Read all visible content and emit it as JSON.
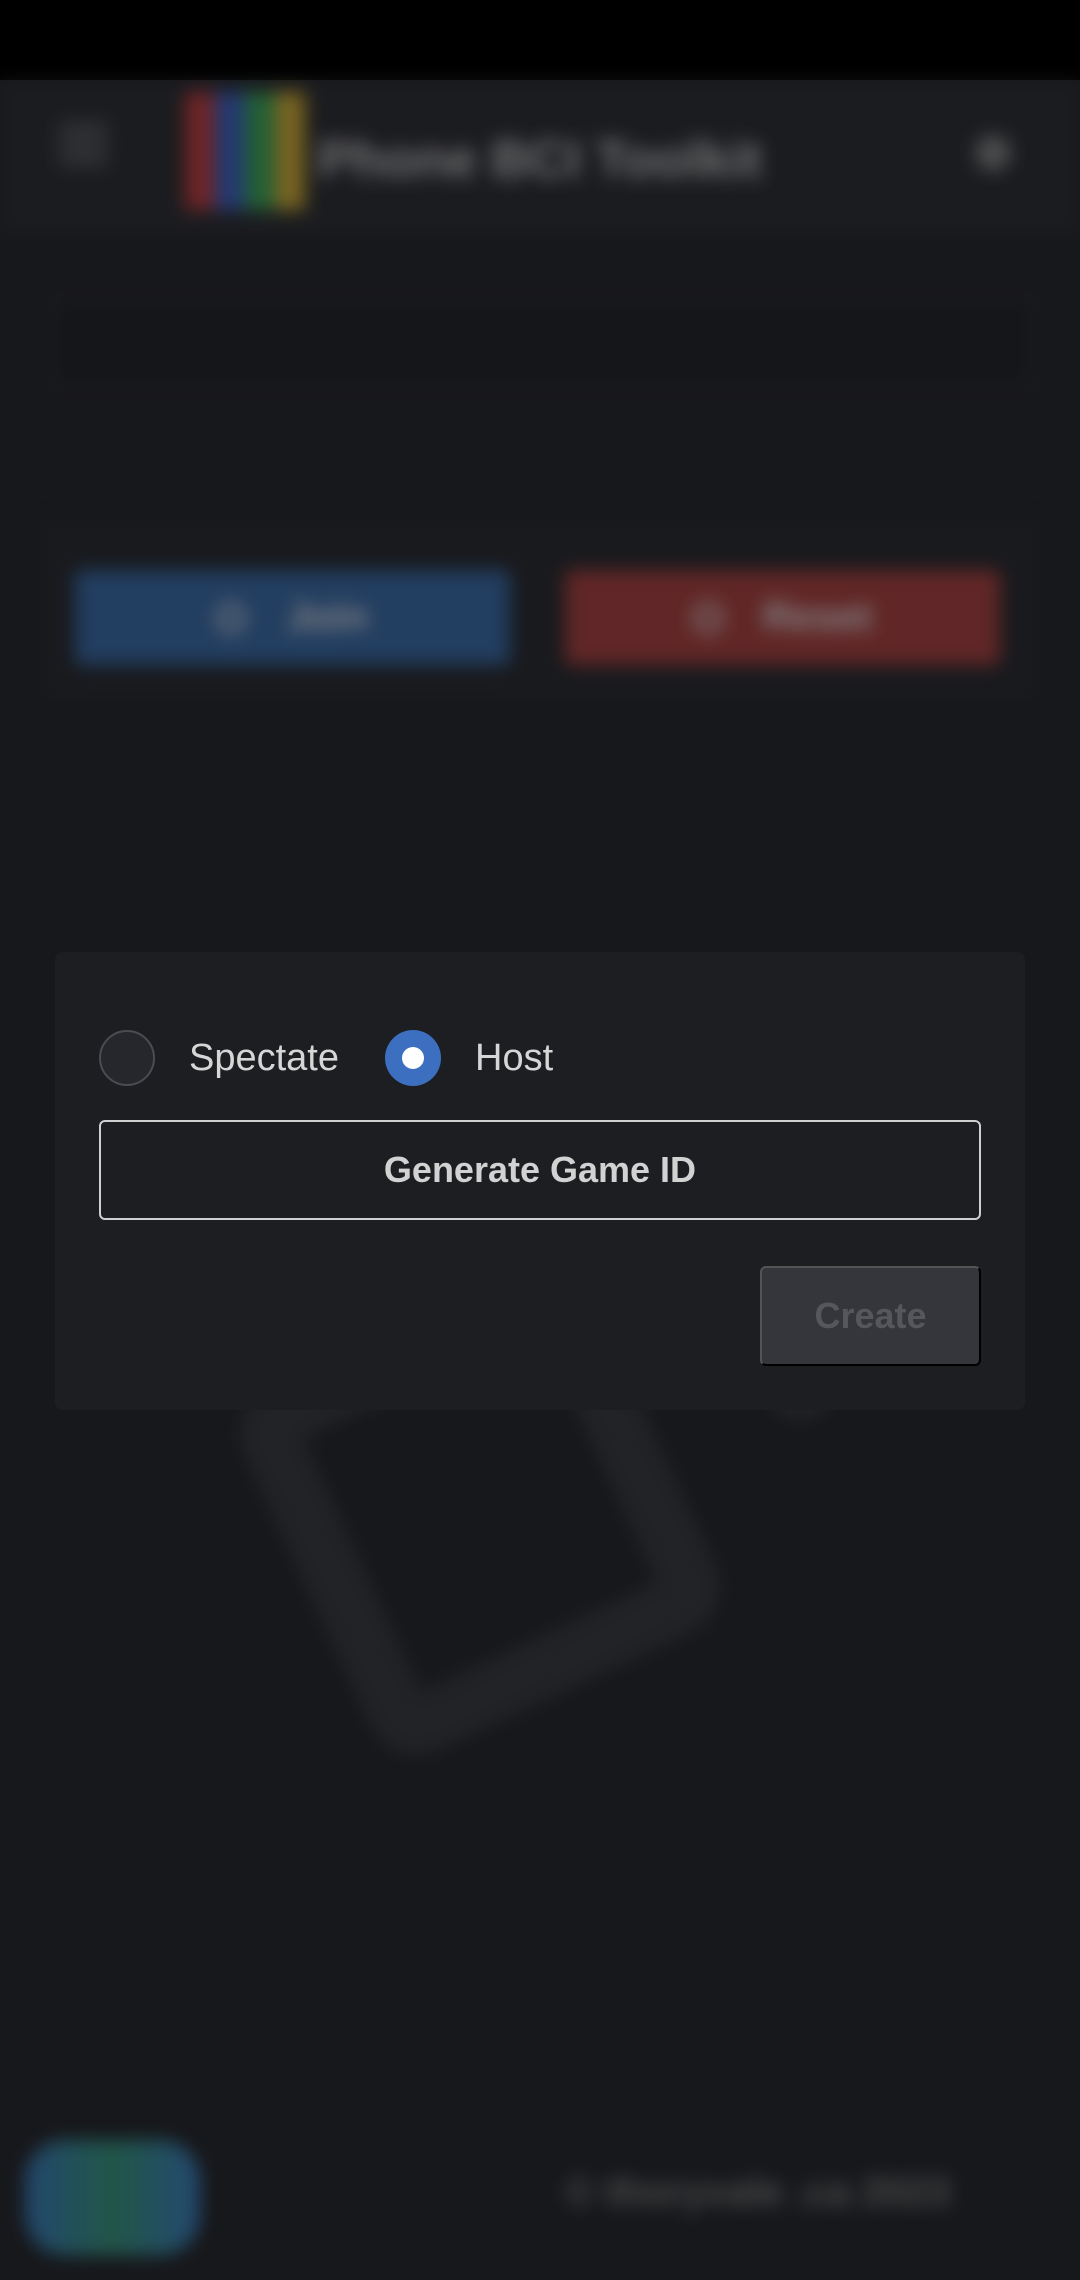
{
  "background": {
    "app_title": "Phone BCI Toolkit",
    "join_label": "Join",
    "reset_label": "Reset",
    "footer_credit": "© thoryvale .ca 2023",
    "logo_colors": [
      "#b53030",
      "#2e55b8",
      "#2e9a4a",
      "#c9a227"
    ]
  },
  "dialog": {
    "options": [
      {
        "label": "Spectate",
        "selected": false
      },
      {
        "label": "Host",
        "selected": true
      }
    ],
    "generate_label": "Generate Game ID",
    "create_label": "Create"
  },
  "colors": {
    "accent": "#3d6fc0",
    "join": "#2c5d99",
    "reset": "#9e3331"
  }
}
